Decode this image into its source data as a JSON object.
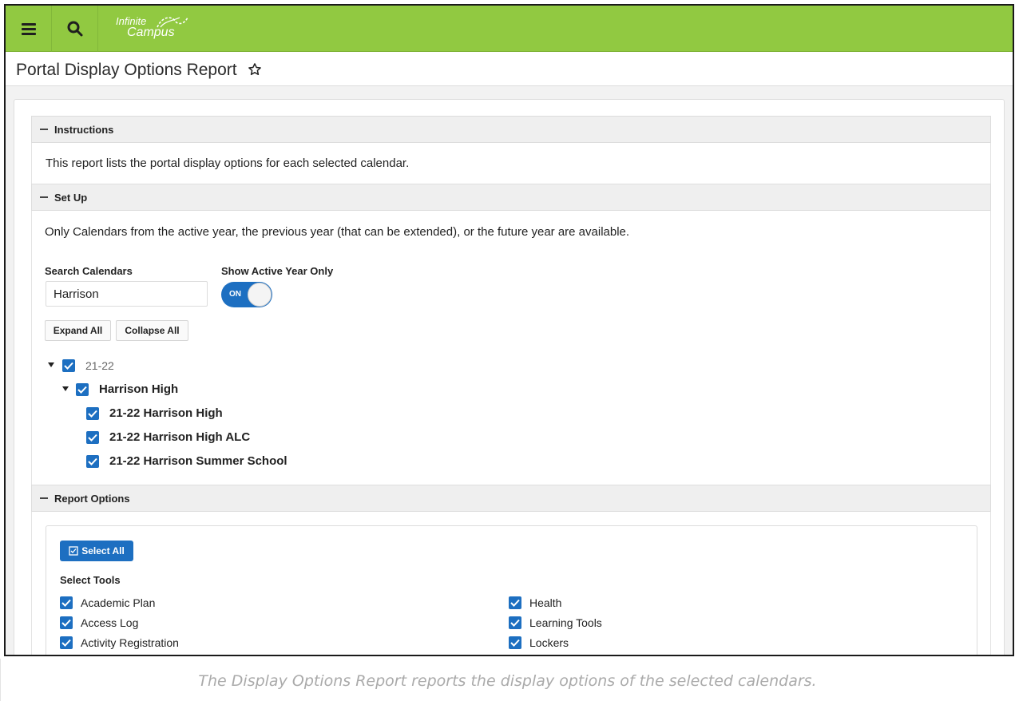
{
  "app": {
    "logo_line1": "Infinite",
    "logo_line2": "Campus"
  },
  "page": {
    "title": "Portal Display Options Report"
  },
  "instructions": {
    "header": "Instructions",
    "text": "This report lists the portal display options for each selected calendar."
  },
  "setup": {
    "header": "Set Up",
    "note": "Only Calendars from the active year, the previous year (that can be extended), or the future year are available.",
    "search_label": "Search Calendars",
    "search_value": "Harrison",
    "toggle_label": "Show Active Year Only",
    "toggle_state": "ON",
    "expand_all": "Expand All",
    "collapse_all": "Collapse All",
    "tree": {
      "year": "21-22",
      "school": "Harrison High",
      "calendars": [
        "21-22 Harrison High",
        "21-22 Harrison High ALC",
        "21-22 Harrison Summer School"
      ]
    }
  },
  "report_options": {
    "header": "Report Options",
    "select_all": "Select All",
    "select_tools_label": "Select Tools",
    "tools_left": [
      "Academic Plan",
      "Access Log",
      "Activity Registration"
    ],
    "tools_right": [
      "Health",
      "Learning Tools",
      "Lockers"
    ]
  },
  "caption": "The Display Options Report reports the display options of the selected calendars.",
  "colors": {
    "topbar": "#91c941",
    "accent": "#1d6fc1"
  }
}
